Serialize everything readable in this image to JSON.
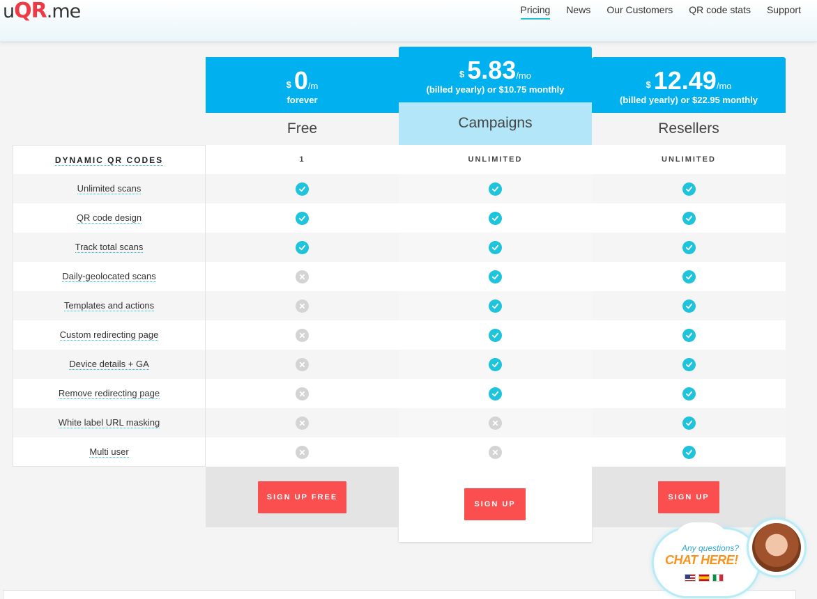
{
  "header": {
    "logo": {
      "u": "u",
      "qr": "QR",
      "me": ".me"
    },
    "nav": [
      "Pricing",
      "News",
      "Our Customers",
      "QR code stats",
      "Support"
    ],
    "active_nav": "Pricing"
  },
  "plans": [
    {
      "currency": "$",
      "amount": "0",
      "period": "/m",
      "sub": "forever",
      "name": "Free",
      "signup": "SIGN UP FREE"
    },
    {
      "currency": "$",
      "amount": "5.83",
      "period": "/mo",
      "sub": "(billed yearly) or $10.75 monthly",
      "name": "Campaigns",
      "signup": "SIGN UP"
    },
    {
      "currency": "$",
      "amount": "12.49",
      "period": "/mo",
      "sub": "(billed yearly) or $22.95 monthly",
      "name": "Resellers",
      "signup": "SIGN UP"
    }
  ],
  "table": {
    "header": {
      "label": "DYNAMIC QR CODES",
      "values": [
        "1",
        "UNLIMITED",
        "UNLIMITED"
      ]
    },
    "features": [
      {
        "label": "Unlimited scans",
        "values": [
          true,
          true,
          true
        ]
      },
      {
        "label": "QR code design",
        "values": [
          true,
          true,
          true
        ]
      },
      {
        "label": "Track total scans",
        "values": [
          true,
          true,
          true
        ]
      },
      {
        "label": "Daily-geolocated scans",
        "values": [
          false,
          true,
          true
        ]
      },
      {
        "label": "Templates and actions",
        "values": [
          false,
          true,
          true
        ]
      },
      {
        "label": "Custom redirecting page",
        "values": [
          false,
          true,
          true
        ]
      },
      {
        "label": "Device details + GA",
        "values": [
          false,
          true,
          true
        ]
      },
      {
        "label": "Remove redirecting page",
        "values": [
          false,
          true,
          true
        ]
      },
      {
        "label": "White label URL masking",
        "values": [
          false,
          false,
          true
        ]
      },
      {
        "label": "Multi user",
        "values": [
          false,
          false,
          true
        ]
      }
    ]
  },
  "chat": {
    "question": "Any questions?",
    "cta": "CHAT HERE!",
    "flags": [
      "us-flag",
      "es-flag",
      "it-flag"
    ]
  },
  "colors": {
    "accent": "#00b0ef",
    "check": "#1ec3dc",
    "signup": "#fb4f4f",
    "logo_red": "#ee3a44"
  }
}
